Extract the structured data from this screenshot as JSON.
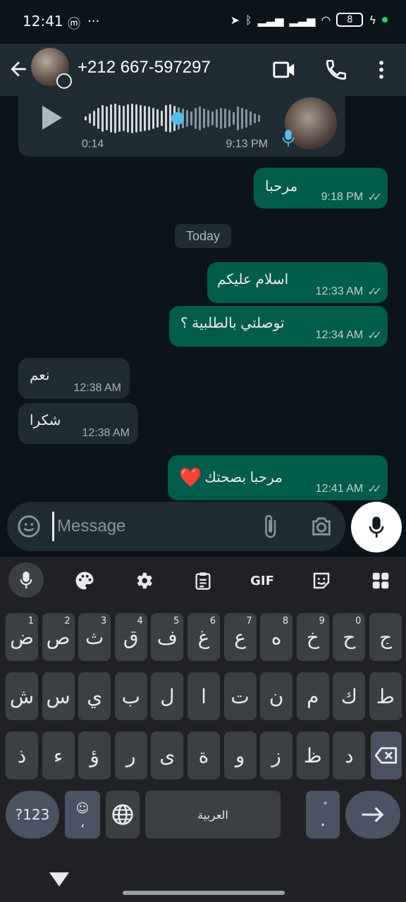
{
  "status": {
    "time": "12:41",
    "battery": "8"
  },
  "header": {
    "contact": "+212 667-597297"
  },
  "voice_note": {
    "duration": "0:14",
    "time": "9:13 PM"
  },
  "messages": [
    {
      "text": "مرحبا",
      "time": "9:18 PM"
    },
    {
      "text": "اسلام عليكم",
      "time": "12:33 AM"
    },
    {
      "text": "توصلتي بالطلبية ؟",
      "time": "12:34 AM"
    },
    {
      "text": "نعم",
      "time": "12:38 AM"
    },
    {
      "text": "شكرا",
      "time": "12:38 AM"
    },
    {
      "text": "مرحبا بصحتك",
      "time": "12:41 AM",
      "emoji": "❤️"
    }
  ],
  "date_chip": "Today",
  "input": {
    "placeholder": "Message"
  },
  "keyboard": {
    "toolbar": {
      "gif": "GIF"
    },
    "row1": [
      "ض",
      "ص",
      "ث",
      "ق",
      "ف",
      "غ",
      "ع",
      "ه",
      "خ",
      "ح",
      "ج"
    ],
    "row1_hints": [
      "1",
      "2",
      "3",
      "4",
      "5",
      "6",
      "7",
      "8",
      "9",
      "0",
      ""
    ],
    "row2": [
      "ش",
      "س",
      "ي",
      "ب",
      "ل",
      "ا",
      "ت",
      "ن",
      "م",
      "ك",
      "ط"
    ],
    "row3": [
      "ذ",
      "ء",
      "ؤ",
      "ر",
      "ى",
      "ة",
      "و",
      "ز",
      "ظ",
      "د"
    ],
    "sym_key": "?123",
    "emoji_key_small": "،",
    "space_label": "العربية",
    "period_key": "."
  },
  "colors": {
    "outgoing_bubble": "#005c4b",
    "incoming_bubble": "#1f2c34",
    "background": "#0b141a",
    "accent_blue": "#53bdeb"
  }
}
